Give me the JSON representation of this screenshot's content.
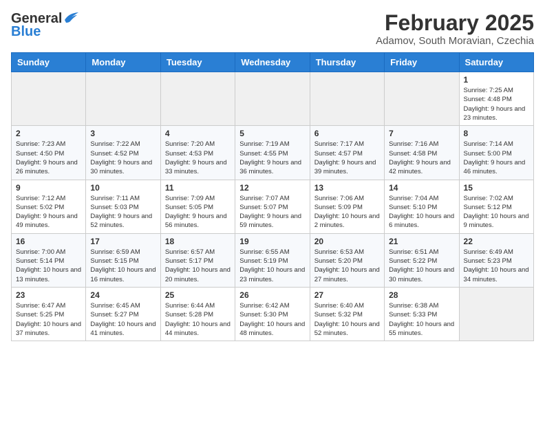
{
  "header": {
    "logo_general": "General",
    "logo_blue": "Blue",
    "month": "February 2025",
    "location": "Adamov, South Moravian, Czechia"
  },
  "weekdays": [
    "Sunday",
    "Monday",
    "Tuesday",
    "Wednesday",
    "Thursday",
    "Friday",
    "Saturday"
  ],
  "weeks": [
    [
      {
        "day": "",
        "info": ""
      },
      {
        "day": "",
        "info": ""
      },
      {
        "day": "",
        "info": ""
      },
      {
        "day": "",
        "info": ""
      },
      {
        "day": "",
        "info": ""
      },
      {
        "day": "",
        "info": ""
      },
      {
        "day": "1",
        "info": "Sunrise: 7:25 AM\nSunset: 4:48 PM\nDaylight: 9 hours and 23 minutes."
      }
    ],
    [
      {
        "day": "2",
        "info": "Sunrise: 7:23 AM\nSunset: 4:50 PM\nDaylight: 9 hours and 26 minutes."
      },
      {
        "day": "3",
        "info": "Sunrise: 7:22 AM\nSunset: 4:52 PM\nDaylight: 9 hours and 30 minutes."
      },
      {
        "day": "4",
        "info": "Sunrise: 7:20 AM\nSunset: 4:53 PM\nDaylight: 9 hours and 33 minutes."
      },
      {
        "day": "5",
        "info": "Sunrise: 7:19 AM\nSunset: 4:55 PM\nDaylight: 9 hours and 36 minutes."
      },
      {
        "day": "6",
        "info": "Sunrise: 7:17 AM\nSunset: 4:57 PM\nDaylight: 9 hours and 39 minutes."
      },
      {
        "day": "7",
        "info": "Sunrise: 7:16 AM\nSunset: 4:58 PM\nDaylight: 9 hours and 42 minutes."
      },
      {
        "day": "8",
        "info": "Sunrise: 7:14 AM\nSunset: 5:00 PM\nDaylight: 9 hours and 46 minutes."
      }
    ],
    [
      {
        "day": "9",
        "info": "Sunrise: 7:12 AM\nSunset: 5:02 PM\nDaylight: 9 hours and 49 minutes."
      },
      {
        "day": "10",
        "info": "Sunrise: 7:11 AM\nSunset: 5:03 PM\nDaylight: 9 hours and 52 minutes."
      },
      {
        "day": "11",
        "info": "Sunrise: 7:09 AM\nSunset: 5:05 PM\nDaylight: 9 hours and 56 minutes."
      },
      {
        "day": "12",
        "info": "Sunrise: 7:07 AM\nSunset: 5:07 PM\nDaylight: 9 hours and 59 minutes."
      },
      {
        "day": "13",
        "info": "Sunrise: 7:06 AM\nSunset: 5:09 PM\nDaylight: 10 hours and 2 minutes."
      },
      {
        "day": "14",
        "info": "Sunrise: 7:04 AM\nSunset: 5:10 PM\nDaylight: 10 hours and 6 minutes."
      },
      {
        "day": "15",
        "info": "Sunrise: 7:02 AM\nSunset: 5:12 PM\nDaylight: 10 hours and 9 minutes."
      }
    ],
    [
      {
        "day": "16",
        "info": "Sunrise: 7:00 AM\nSunset: 5:14 PM\nDaylight: 10 hours and 13 minutes."
      },
      {
        "day": "17",
        "info": "Sunrise: 6:59 AM\nSunset: 5:15 PM\nDaylight: 10 hours and 16 minutes."
      },
      {
        "day": "18",
        "info": "Sunrise: 6:57 AM\nSunset: 5:17 PM\nDaylight: 10 hours and 20 minutes."
      },
      {
        "day": "19",
        "info": "Sunrise: 6:55 AM\nSunset: 5:19 PM\nDaylight: 10 hours and 23 minutes."
      },
      {
        "day": "20",
        "info": "Sunrise: 6:53 AM\nSunset: 5:20 PM\nDaylight: 10 hours and 27 minutes."
      },
      {
        "day": "21",
        "info": "Sunrise: 6:51 AM\nSunset: 5:22 PM\nDaylight: 10 hours and 30 minutes."
      },
      {
        "day": "22",
        "info": "Sunrise: 6:49 AM\nSunset: 5:23 PM\nDaylight: 10 hours and 34 minutes."
      }
    ],
    [
      {
        "day": "23",
        "info": "Sunrise: 6:47 AM\nSunset: 5:25 PM\nDaylight: 10 hours and 37 minutes."
      },
      {
        "day": "24",
        "info": "Sunrise: 6:45 AM\nSunset: 5:27 PM\nDaylight: 10 hours and 41 minutes."
      },
      {
        "day": "25",
        "info": "Sunrise: 6:44 AM\nSunset: 5:28 PM\nDaylight: 10 hours and 44 minutes."
      },
      {
        "day": "26",
        "info": "Sunrise: 6:42 AM\nSunset: 5:30 PM\nDaylight: 10 hours and 48 minutes."
      },
      {
        "day": "27",
        "info": "Sunrise: 6:40 AM\nSunset: 5:32 PM\nDaylight: 10 hours and 52 minutes."
      },
      {
        "day": "28",
        "info": "Sunrise: 6:38 AM\nSunset: 5:33 PM\nDaylight: 10 hours and 55 minutes."
      },
      {
        "day": "",
        "info": ""
      }
    ]
  ]
}
